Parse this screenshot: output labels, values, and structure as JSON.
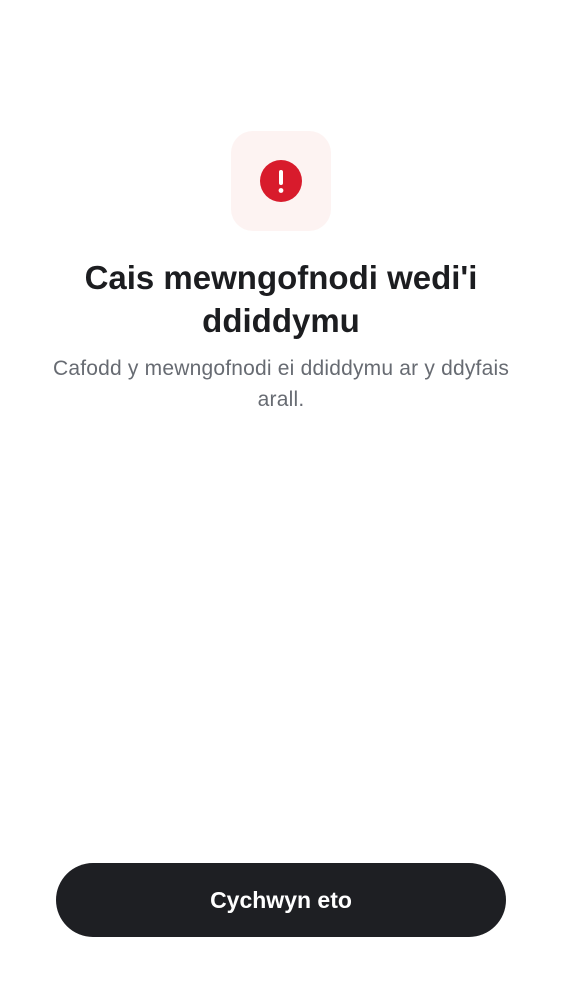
{
  "status": {
    "icon": "alert-circle-icon",
    "icon_color": "#d81b2c",
    "tile_color": "#fdf3f2"
  },
  "title": "Cais mewngofnodi wedi'i ddiddymu",
  "message": "Cafodd y mewngofnodi ei ddiddymu ar y ddyfais arall.",
  "actions": {
    "retry_label": "Cychwyn eto",
    "retry_color": "#1e1f23"
  }
}
